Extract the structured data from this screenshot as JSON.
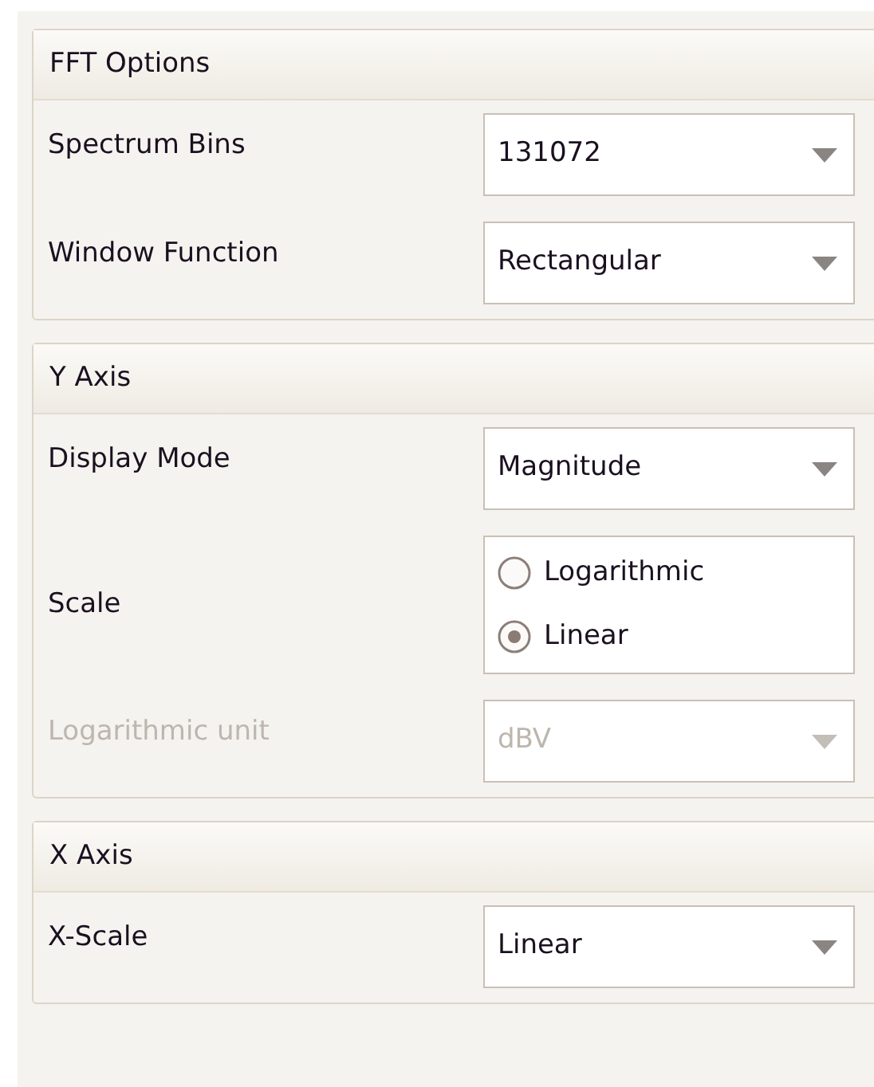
{
  "groups": [
    {
      "title": "FFT Options",
      "rows": [
        {
          "kind": "dropdown",
          "label": "Spectrum Bins",
          "value": "131072",
          "disabled": false
        },
        {
          "kind": "dropdown",
          "label": "Window Function",
          "value": "Rectangular",
          "disabled": false
        }
      ]
    },
    {
      "title": "Y Axis",
      "rows": [
        {
          "kind": "dropdown",
          "label": "Display Mode",
          "value": "Magnitude",
          "disabled": false
        },
        {
          "kind": "radio",
          "label": "Scale",
          "options": [
            {
              "label": "Logarithmic",
              "selected": false
            },
            {
              "label": "Linear",
              "selected": true
            }
          ]
        },
        {
          "kind": "dropdown",
          "label": "Logarithmic unit",
          "value": "dBV",
          "disabled": true
        }
      ]
    },
    {
      "title": "X Axis",
      "rows": [
        {
          "kind": "dropdown",
          "label": "X-Scale",
          "value": "Linear",
          "disabled": false
        }
      ]
    }
  ]
}
